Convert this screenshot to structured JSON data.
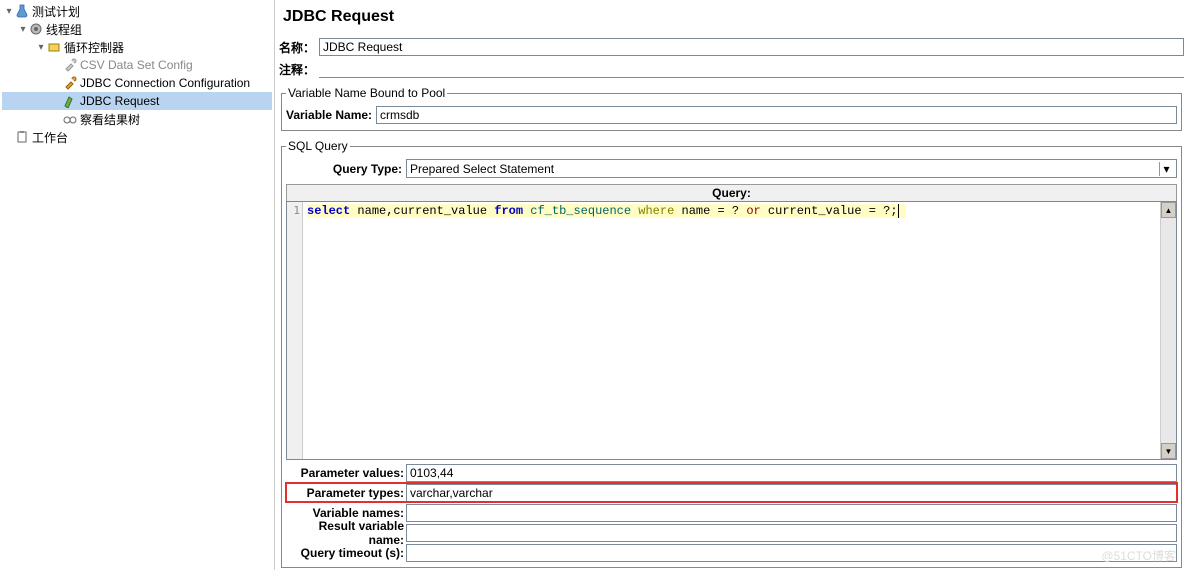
{
  "tree": {
    "test_plan": "测试计划",
    "thread_group": "线程组",
    "loop_controller": "循环控制器",
    "csv_config": "CSV Data Set Config",
    "jdbc_conn": "JDBC Connection Configuration",
    "jdbc_request": "JDBC Request",
    "results_tree": "察看结果树",
    "workbench": "工作台"
  },
  "panel": {
    "title": "JDBC Request",
    "name_label": "名称：",
    "name_value": "JDBC Request",
    "comment_label": "注释："
  },
  "pool": {
    "legend": "Variable Name Bound to Pool",
    "var_name_label": "Variable Name:",
    "var_name_value": "crmsdb"
  },
  "sql": {
    "legend": "SQL Query",
    "query_type_label": "Query Type:",
    "query_type_value": "Prepared Select Statement",
    "query_header": "Query:",
    "line_no": "1",
    "kw_select": "select",
    "cols": " name,current_value ",
    "kw_from": "from",
    "table": " cf_tb_sequence ",
    "kw_where": "where",
    "expr1": " name = ? ",
    "kw_or": "or",
    "expr2": " current_value = ?;"
  },
  "params": {
    "values_label": "Parameter values:",
    "values_value": "0103,44",
    "types_label": "Parameter types:",
    "types_value": "varchar,varchar",
    "varnames_label": "Variable names:",
    "resultvar_label": "Result variable name:",
    "timeout_label": "Query timeout (s):"
  },
  "watermark": "@51CTO博客"
}
